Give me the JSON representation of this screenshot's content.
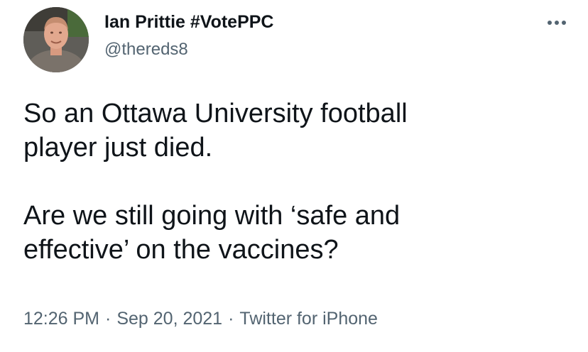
{
  "author": {
    "display_name": "Ian Prittie #VotePPC",
    "handle": "@thereds8"
  },
  "tweet": {
    "paragraph_1_line_1": "So an Ottawa University football",
    "paragraph_1_line_2": "player just died.",
    "paragraph_2_line_1": "Are we still going with ‘safe and",
    "paragraph_2_line_2": "effective’ on the vaccines?"
  },
  "meta": {
    "time": "12:26 PM",
    "separator": "·",
    "date": "Sep 20, 2021",
    "source": "Twitter for iPhone"
  },
  "icons": {
    "more": "more-horizontal-icon",
    "avatar": "profile-photo"
  },
  "colors": {
    "text_primary": "#0f1419",
    "text_secondary": "#536471",
    "background": "#ffffff"
  }
}
